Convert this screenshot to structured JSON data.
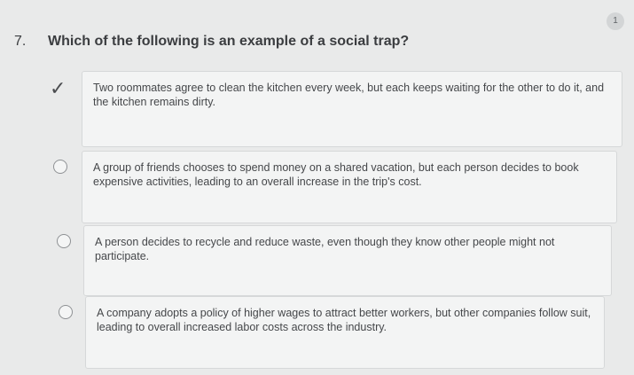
{
  "points_badge": "1",
  "question": {
    "number": "7.",
    "text": "Which of the following is an example of a social trap?"
  },
  "options": [
    {
      "text": "Two roommates agree to clean the kitchen every week, but each keeps waiting for the other to do it, and the kitchen remains dirty.",
      "selected": true
    },
    {
      "text": "A group of friends chooses to spend money on a shared vacation, but each person decides to book expensive activities, leading to an overall increase in the trip's cost.",
      "selected": false
    },
    {
      "text": "A person decides to recycle and reduce waste, even though they know other people might not participate.",
      "selected": false
    },
    {
      "text": "A company adopts a policy of higher wages to attract better workers, but other companies follow suit, leading to overall increased labor costs across the industry.",
      "selected": false
    }
  ],
  "icons": {
    "selected_mark": "check-icon",
    "unselected_mark": "radio-circle"
  }
}
